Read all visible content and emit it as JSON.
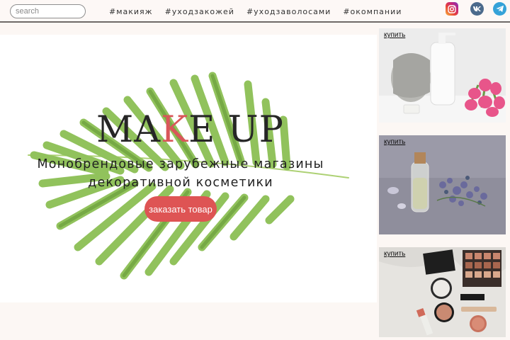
{
  "header": {
    "search_placeholder": "search",
    "nav": [
      "#макияж",
      "#уходзакожей",
      "#уходзаволосами",
      "#окомпании"
    ],
    "social": [
      {
        "icon": "instagram-icon",
        "color": "#c4267c"
      },
      {
        "icon": "vk-icon",
        "color": "#4b6a8c",
        "label": "vk"
      },
      {
        "icon": "telegram-icon",
        "color": "#35a2d8"
      }
    ]
  },
  "hero": {
    "title_start": "MA",
    "title_accent": "K",
    "title_end": "E UP",
    "subtitle_line1": "Монобрендовые зарубежные магазины",
    "subtitle_line2": "декоративной косметики",
    "button_label": "заказать товар",
    "accent_color": "#de5454"
  },
  "cards": [
    {
      "buy_label": "купить",
      "image": "towel-bottle-tulips-photo"
    },
    {
      "buy_label": "купить",
      "image": "oil-vial-lavender-photo"
    },
    {
      "buy_label": "купить",
      "image": "makeup-products-photo"
    }
  ]
}
